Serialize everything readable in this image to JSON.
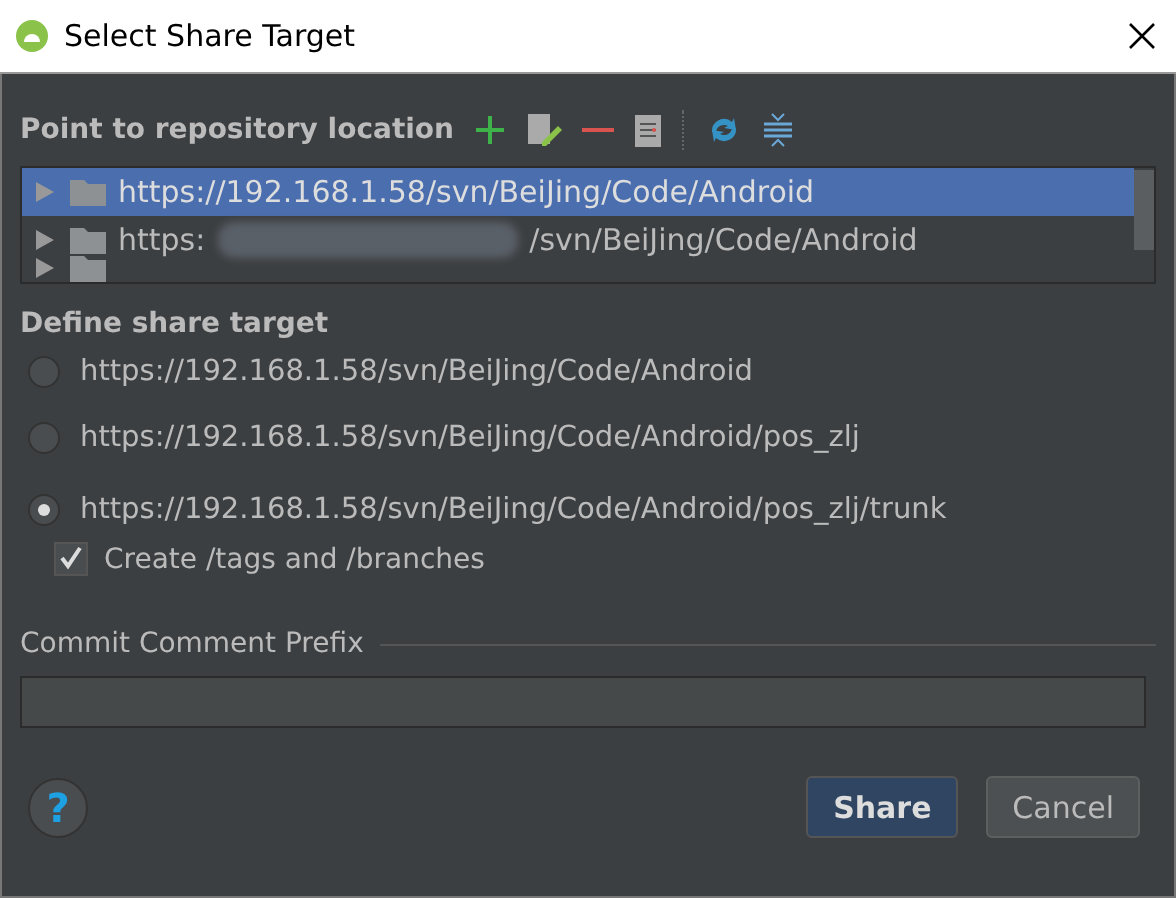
{
  "window": {
    "title": "Select Share Target"
  },
  "repository": {
    "label": "Point to repository location",
    "locations": [
      {
        "text": "https://192.168.1.58/svn/BeiJing/Code/Android",
        "selected": true,
        "expanded": false,
        "kind": "plain"
      },
      {
        "text": "https:",
        "text_after": "/svn/BeiJing/Code/Android",
        "selected": false,
        "expanded": false,
        "kind": "blurred"
      },
      {
        "selected": false,
        "expanded": false,
        "kind": "cut"
      }
    ]
  },
  "share_target": {
    "label": "Define share target",
    "options": [
      {
        "text": "https://192.168.1.58/svn/BeiJing/Code/Android",
        "selected": false
      },
      {
        "text": "https://192.168.1.58/svn/BeiJing/Code/Android/pos_zlj",
        "selected": false
      },
      {
        "text": "https://192.168.1.58/svn/BeiJing/Code/Android/pos_zlj/trunk",
        "selected": true
      }
    ],
    "create_tags": {
      "label": "Create /tags and /branches",
      "checked": true
    }
  },
  "commit_prefix": {
    "label": "Commit Comment Prefix"
  },
  "help": {
    "label": "?"
  },
  "buttons": [
    {
      "label": "Share",
      "kind": "default"
    },
    {
      "label": "Cancel",
      "kind": "normal"
    }
  ]
}
